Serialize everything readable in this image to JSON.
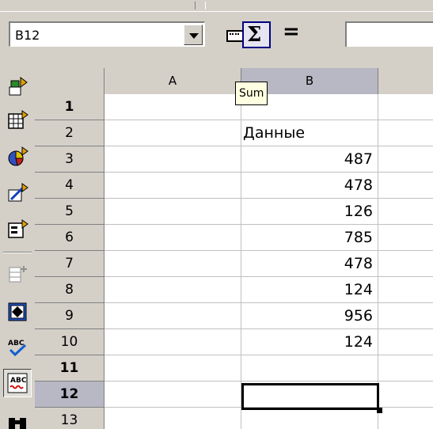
{
  "name_box": {
    "value": "B12"
  },
  "formula_bar": {
    "function_wizard_icon": "keyboard-icon",
    "sum_icon": "sigma-icon",
    "sum_glyph": "Σ",
    "equals_glyph": "=",
    "formula_value": ""
  },
  "tooltip": {
    "text": "Sum"
  },
  "columns": [
    {
      "label": "A"
    },
    {
      "label": "B"
    },
    {
      "label": ""
    }
  ],
  "rows": [
    {
      "label": "1",
      "a": "",
      "b": ""
    },
    {
      "label": "2",
      "a": "",
      "b": "Данные"
    },
    {
      "label": "3",
      "a": "",
      "b": "487"
    },
    {
      "label": "4",
      "a": "",
      "b": "478"
    },
    {
      "label": "5",
      "a": "",
      "b": "126"
    },
    {
      "label": "6",
      "a": "",
      "b": "785"
    },
    {
      "label": "7",
      "a": "",
      "b": "478"
    },
    {
      "label": "8",
      "a": "",
      "b": "124"
    },
    {
      "label": "9",
      "a": "",
      "b": "956"
    },
    {
      "label": "10",
      "a": "",
      "b": "124"
    },
    {
      "label": "11",
      "a": "",
      "b": ""
    },
    {
      "label": "12",
      "a": "",
      "b": ""
    },
    {
      "label": "13",
      "a": "",
      "b": ""
    }
  ],
  "left_toolbar": [
    "insert-cells-icon",
    "insert-object-icon",
    "insert-chart-icon",
    "draw-functions-icon",
    "form-controls-icon",
    "insert-rows-icon",
    "navigator-icon",
    "spellcheck-icon",
    "autospellcheck-icon",
    "find-icon"
  ],
  "colors": {
    "chrome": "#d4d0c8",
    "selected_header": "#b8b8c4",
    "tooltip_bg": "#ffffe1",
    "grid_line": "#c0c0c0"
  }
}
